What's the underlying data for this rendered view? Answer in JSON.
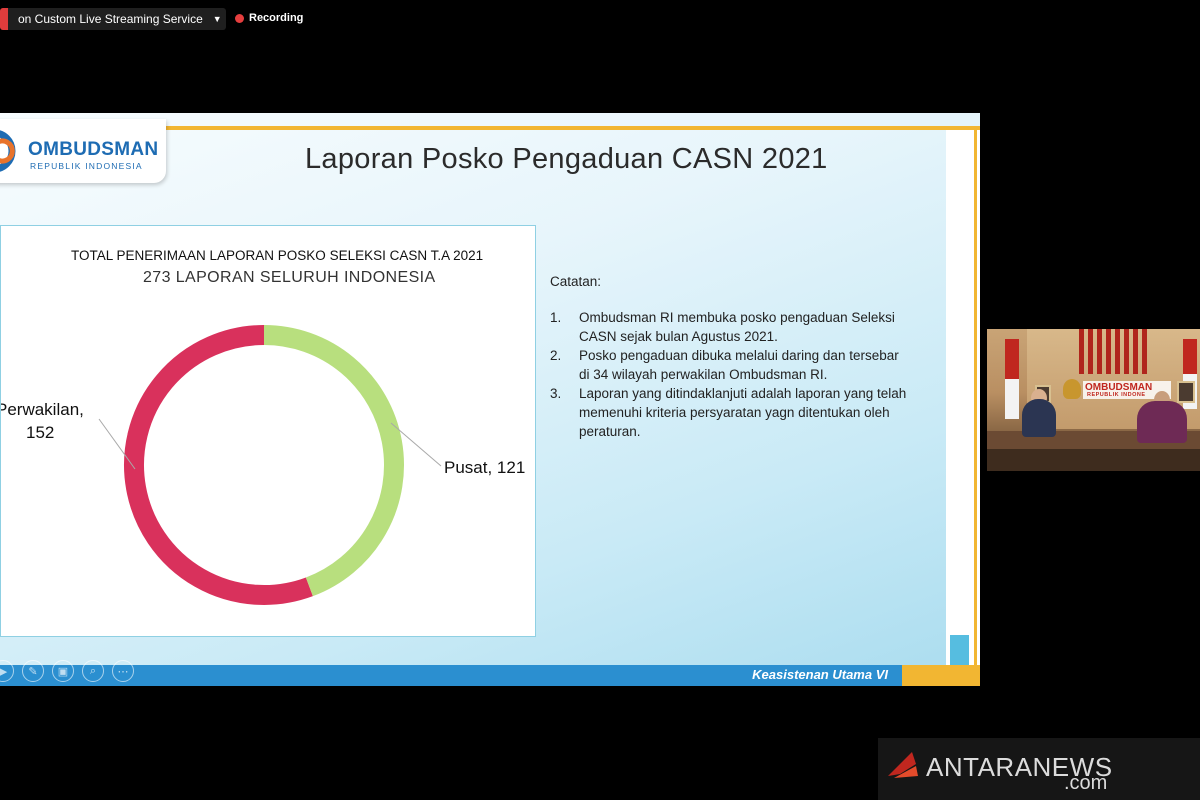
{
  "stream": {
    "title": "on Custom Live Streaming Service",
    "recording_label": "Recording"
  },
  "slide": {
    "logo_name": "OMBUDSMAN",
    "logo_sub": "REPUBLIK INDONESIA",
    "title": "Laporan Posko Pengaduan CASN 2021",
    "notes_heading": "Catatan:",
    "notes": [
      {
        "num": "1.",
        "text": "Ombudsman RI membuka posko pengaduan Seleksi CASN sejak bulan Agustus 2021."
      },
      {
        "num": "2.",
        "text": "Posko pengaduan dibuka melalui daring dan tersebar di 34 wilayah perwakilan Ombudsman RI."
      },
      {
        "num": "3.",
        "text": "Laporan yang ditindaklanjuti adalah laporan yang telah memenuhi kriteria persyaratan yagn ditentukan oleh peraturan."
      }
    ],
    "footer": "Keasistenan Utama VI"
  },
  "chart_data": {
    "type": "pie",
    "title": "TOTAL PENERIMAAN LAPORAN POSKO  SELEKSI CASN T.A 2021",
    "subtitle": "273 LAPORAN SELURUH INDONESIA",
    "categories": [
      "Pusat",
      "Perwakilan"
    ],
    "values": [
      121,
      152
    ],
    "labels": [
      "Pusat, 121",
      "Perwakilan,",
      "152"
    ],
    "colors": [
      "#b8df7e",
      "#d9315c"
    ]
  },
  "camera": {
    "sign_text": "OMBUDSMAN",
    "sign_sub": "REPUBLIK INDONE"
  },
  "watermark": {
    "text": "ANTARANEWS",
    "suffix": ".com"
  },
  "colors": {
    "accent_blue": "#2b8fd0",
    "accent_yellow": "#f2b632",
    "recording_red": "#e53e3e"
  }
}
